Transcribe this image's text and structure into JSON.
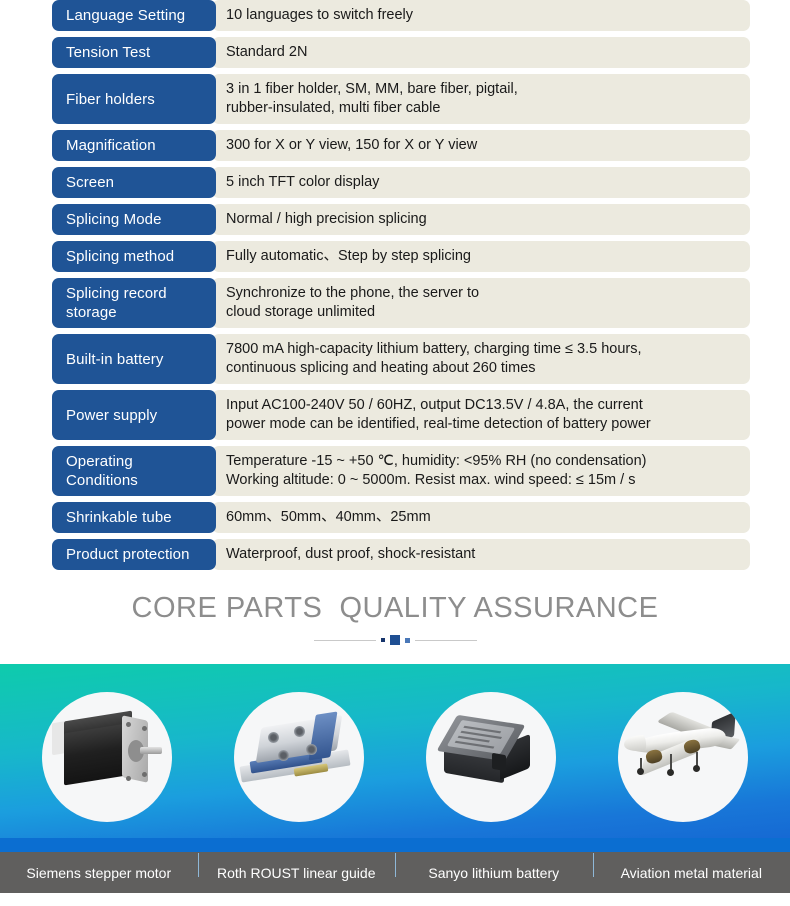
{
  "spec_table": {
    "rows": [
      {
        "label": "Language Setting",
        "value": "10 languages to switch freely"
      },
      {
        "label": "Tension Test",
        "value": "Standard 2N"
      },
      {
        "label": "Fiber holders",
        "value": "3 in 1 fiber holder, SM, MM, bare fiber, pigtail,\nrubber-insulated, multi fiber cable"
      },
      {
        "label": "Magnification",
        "value": "300 for X or Y view, 150 for X or Y view"
      },
      {
        "label": "Screen",
        "value": "5 inch TFT color display"
      },
      {
        "label": "Splicing Mode",
        "value": "Normal / high precision splicing"
      },
      {
        "label": "Splicing method",
        "value": "Fully automatic、Step by step splicing"
      },
      {
        "label": "Splicing record\nstorage",
        "value": "Synchronize to the phone, the server to\ncloud storage unlimited"
      },
      {
        "label": "Built-in battery",
        "value": "7800 mA high-capacity lithium battery, charging time ≤ 3.5 hours,\ncontinuous splicing and heating about 260 times"
      },
      {
        "label": "Power supply",
        "value": "Input AC100-240V 50 / 60HZ, output DC13.5V / 4.8A, the current\npower mode can be identified, real-time detection of battery power"
      },
      {
        "label": "Operating\nConditions",
        "value": "Temperature -15 ~ +50 ℃, humidity: <95% RH (no condensation)\nWorking altitude: 0 ~ 5000m. Resist max. wind speed: ≤ 15m / s"
      },
      {
        "label": "Shrinkable tube",
        "value": "60mm、50mm、40mm、25mm"
      },
      {
        "label": "Product protection",
        "value": "Waterproof, dust proof, shock-resistant"
      }
    ],
    "label_color": "#1f5496",
    "value_bg_color": "#eceadf"
  },
  "core_parts": {
    "title": "CORE PARTS  QUALITY ASSURANCE",
    "title_color": "#8d8d8d",
    "band_gradient_from": "#0ecbac",
    "band_gradient_to": "#1565d2",
    "items": [
      {
        "label": "Siemens stepper motor",
        "image": "stepper-motor"
      },
      {
        "label": "Roth ROUST linear guide",
        "image": "linear-guide"
      },
      {
        "label": "Sanyo lithium battery",
        "image": "lithium-battery"
      },
      {
        "label": "Aviation metal material",
        "image": "aviation-metal"
      }
    ],
    "bar_color": "#0b6ed1",
    "label_bar_color": "#605f5e"
  }
}
